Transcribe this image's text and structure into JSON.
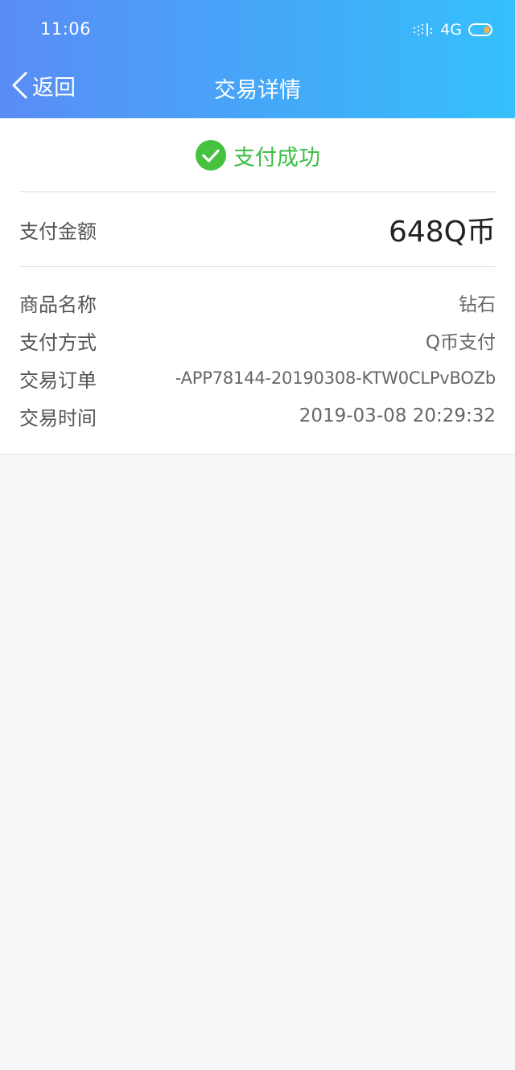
{
  "status_bar": {
    "time": "11:06",
    "network": "4G",
    "icons": [
      "signal-icon",
      "battery-icon"
    ]
  },
  "nav": {
    "back_label": "返回",
    "title": "交易详情"
  },
  "payment": {
    "status_text": "支付成功",
    "status_color": "#3cbf44",
    "amount_label": "支付金额",
    "amount_value": "648Q币"
  },
  "details": [
    {
      "label": "商品名称",
      "value": "钻石"
    },
    {
      "label": "支付方式",
      "value": "Q币支付"
    },
    {
      "label": "交易订单",
      "value": "-APP78144-20190308-KTW0CLPvBOZb"
    },
    {
      "label": "交易时间",
      "value": "2019-03-08 20:29:32"
    }
  ],
  "colors": {
    "header_gradient_start": "#5a8cf5",
    "header_gradient_end": "#35c0fb",
    "background": "#f6f7f9"
  }
}
